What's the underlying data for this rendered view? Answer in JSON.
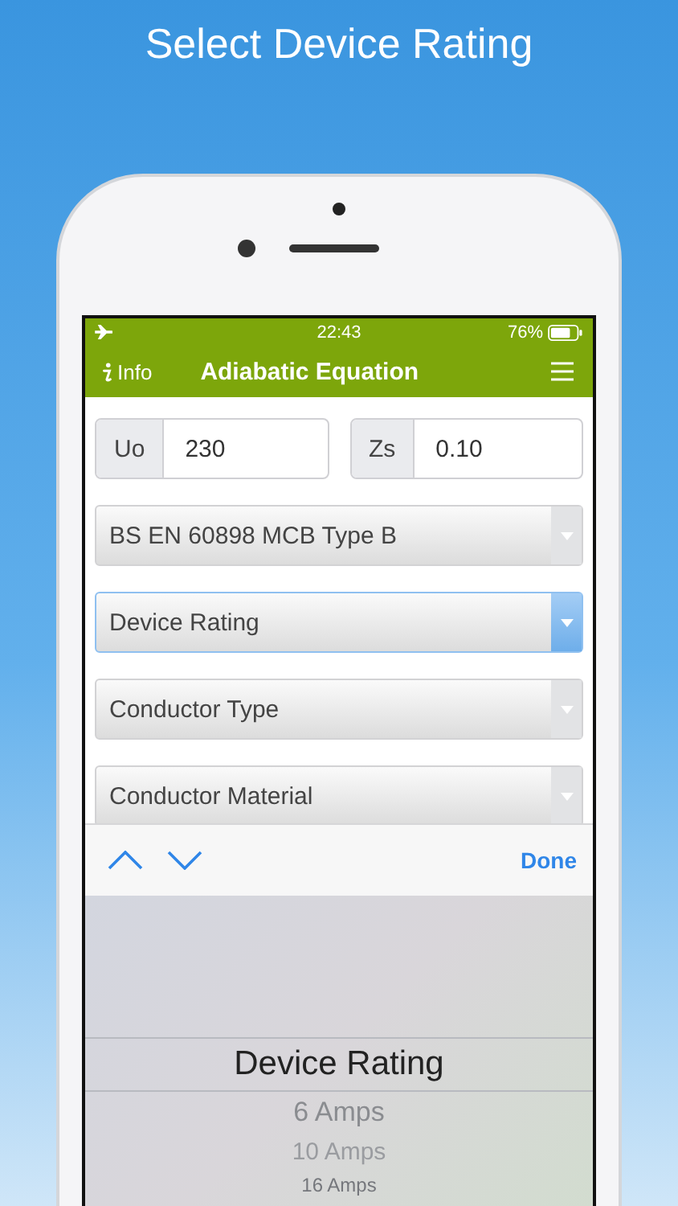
{
  "page_title": "Select Device Rating",
  "status_bar": {
    "time": "22:43",
    "battery": "76%"
  },
  "nav_bar": {
    "info_label": "Info",
    "title": "Adiabatic Equation"
  },
  "inputs": [
    {
      "label": "Uo",
      "value": "230"
    },
    {
      "label": "Zs",
      "value": "0.10"
    }
  ],
  "selects": [
    {
      "value": "BS EN 60898 MCB Type B",
      "focused": false
    },
    {
      "value": "Device Rating",
      "focused": true
    },
    {
      "value": "Conductor Type",
      "focused": false
    },
    {
      "value": "Conductor Material",
      "focused": false
    }
  ],
  "toolbar": {
    "done": "Done"
  },
  "picker": {
    "items": [
      {
        "label": "Device Rating",
        "selected": true
      },
      {
        "label": "6 Amps",
        "selected": false
      },
      {
        "label": "10 Amps",
        "selected": false
      },
      {
        "label": "16 Amps",
        "selected": false
      }
    ]
  }
}
